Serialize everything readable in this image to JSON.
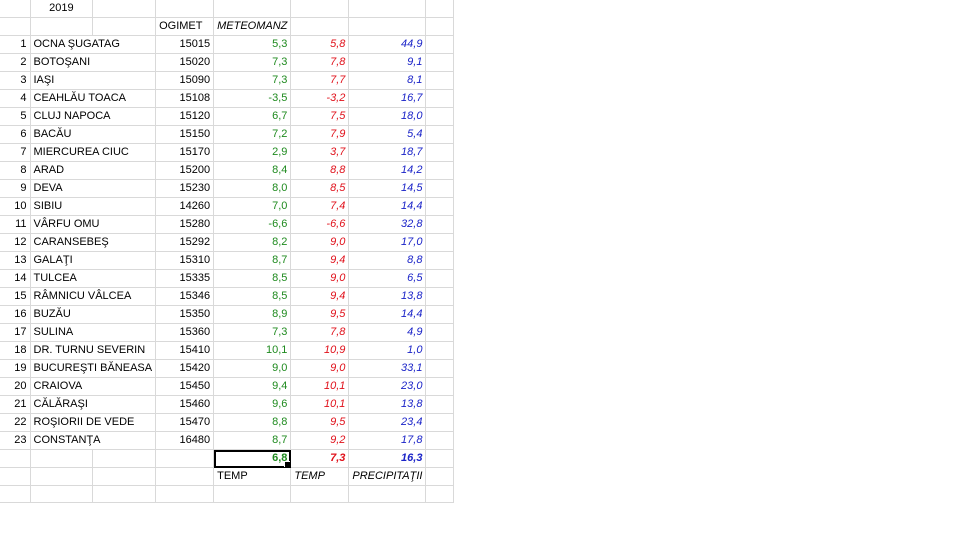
{
  "sheet": {
    "year": "2019",
    "headers": {
      "ogimet": "OGIMET",
      "meteomanz": "METEOMANZ"
    },
    "rows": [
      {
        "n": "1",
        "name": "OCNA ŞUGATAG",
        "code": "15015",
        "og": "5,3",
        "me": "5,8",
        "pr": "44,9"
      },
      {
        "n": "2",
        "name": "BOTOŞANI",
        "code": "15020",
        "og": "7,3",
        "me": "7,8",
        "pr": "9,1"
      },
      {
        "n": "3",
        "name": "IAŞI",
        "code": "15090",
        "og": "7,3",
        "me": "7,7",
        "pr": "8,1"
      },
      {
        "n": "4",
        "name": "CEAHLĂU TOACA",
        "code": "15108",
        "og": "-3,5",
        "me": "-3,2",
        "pr": "16,7"
      },
      {
        "n": "5",
        "name": "CLUJ NAPOCA",
        "code": "15120",
        "og": "6,7",
        "me": "7,5",
        "pr": "18,0"
      },
      {
        "n": "6",
        "name": "BACĂU",
        "code": "15150",
        "og": "7,2",
        "me": "7,9",
        "pr": "5,4"
      },
      {
        "n": "7",
        "name": "MIERCUREA CIUC",
        "code": "15170",
        "og": "2,9",
        "me": "3,7",
        "pr": "18,7"
      },
      {
        "n": "8",
        "name": "ARAD",
        "code": "15200",
        "og": "8,4",
        "me": "8,8",
        "pr": "14,2"
      },
      {
        "n": "9",
        "name": "DEVA",
        "code": "15230",
        "og": "8,0",
        "me": "8,5",
        "pr": "14,5"
      },
      {
        "n": "10",
        "name": "SIBIU",
        "code": "14260",
        "og": "7,0",
        "me": "7,4",
        "pr": "14,4"
      },
      {
        "n": "11",
        "name": "VÂRFU OMU",
        "code": "15280",
        "og": "-6,6",
        "me": "-6,6",
        "pr": "32,8"
      },
      {
        "n": "12",
        "name": "CARANSEBEŞ",
        "code": "15292",
        "og": "8,2",
        "me": "9,0",
        "pr": "17,0"
      },
      {
        "n": "13",
        "name": "GALAŢI",
        "code": "15310",
        "og": "8,7",
        "me": "9,4",
        "pr": "8,8"
      },
      {
        "n": "14",
        "name": "TULCEA",
        "code": "15335",
        "og": "8,5",
        "me": "9,0",
        "pr": "6,5"
      },
      {
        "n": "15",
        "name": "RÂMNICU VÂLCEA",
        "code": "15346",
        "og": "8,5",
        "me": "9,4",
        "pr": "13,8"
      },
      {
        "n": "16",
        "name": "BUZĂU",
        "code": "15350",
        "og": "8,9",
        "me": "9,5",
        "pr": "14,4"
      },
      {
        "n": "17",
        "name": "SULINA",
        "code": "15360",
        "og": "7,3",
        "me": "7,8",
        "pr": "4,9"
      },
      {
        "n": "18",
        "name": "DR. TURNU SEVERIN",
        "code": "15410",
        "og": "10,1",
        "me": "10,9",
        "pr": "1,0"
      },
      {
        "n": "19",
        "name": "BUCUREŞTI BĂNEASA",
        "code": "15420",
        "og": "9,0",
        "me": "9,0",
        "pr": "33,1"
      },
      {
        "n": "20",
        "name": "CRAIOVA",
        "code": "15450",
        "og": "9,4",
        "me": "10,1",
        "pr": "23,0"
      },
      {
        "n": "21",
        "name": "CĂLĂRAŞI",
        "code": "15460",
        "og": "9,6",
        "me": "10,1",
        "pr": "13,8"
      },
      {
        "n": "22",
        "name": "ROŞIORII DE VEDE",
        "code": "15470",
        "og": "8,8",
        "me": "9,5",
        "pr": "23,4"
      },
      {
        "n": "23",
        "name": "CONSTANŢA",
        "code": "16480",
        "og": "8,7",
        "me": "9,2",
        "pr": "17,8"
      }
    ],
    "totals": {
      "og": "6,8",
      "me": "7,3",
      "pr": "16,3"
    },
    "footer": {
      "og": "TEMP",
      "me": "TEMP",
      "pr": "PRECIPITAŢII"
    },
    "colors": {
      "ogimet": "#1e8a1e",
      "meteomanz": "#e0101a",
      "precip": "#1a23c8",
      "gridline": "#d9d9d9"
    }
  }
}
